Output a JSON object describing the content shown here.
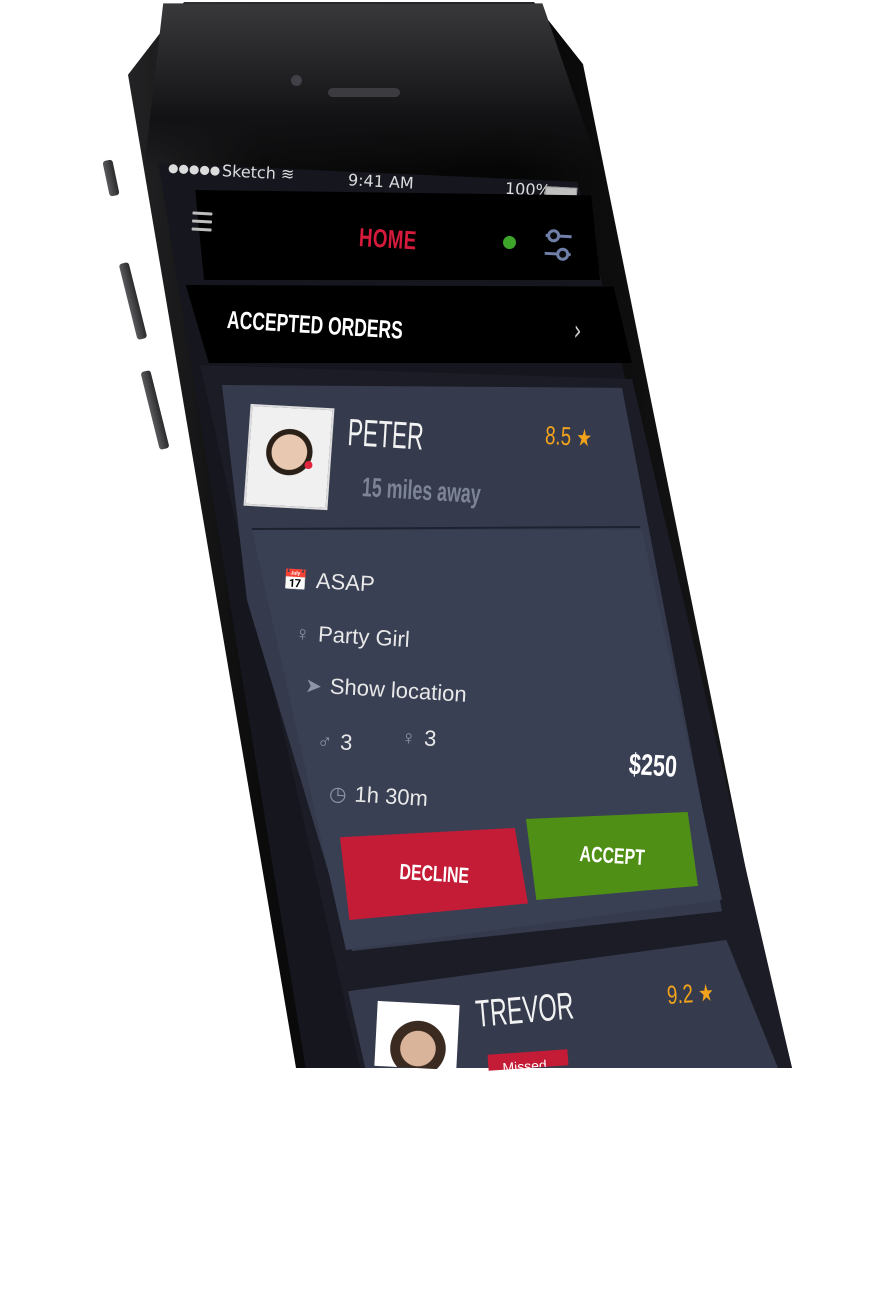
{
  "status_bar": {
    "signal": "●●●●●",
    "carrier": "Sketch",
    "time": "9:41 AM",
    "battery": "100%"
  },
  "header": {
    "title": "HOME",
    "title_color": "#d61a3c",
    "online_color": "#3ea52b",
    "menu_icon": "hamburger-icon",
    "filter_icon": "sliders-icon"
  },
  "orders_bar": {
    "label": "ACCEPTED ORDERS",
    "chevron": "›"
  },
  "cards": [
    {
      "name": "PETER",
      "distance": "15 miles away",
      "rating": "8.5",
      "details": {
        "when": "ASAP",
        "role": "Party Girl",
        "location": "Show location",
        "men_count": "3",
        "women_count": "3",
        "duration": "1h 30m"
      },
      "price": "$250",
      "decline_label": "DECLINE",
      "accept_label": "ACCEPT"
    },
    {
      "name": "TREVOR",
      "rating": "9.2",
      "badge": "Missed"
    }
  ],
  "colors": {
    "decline": "#c41b36",
    "accept": "#4f8f16",
    "rating": "#f2a31b",
    "card": "#353b4d"
  }
}
